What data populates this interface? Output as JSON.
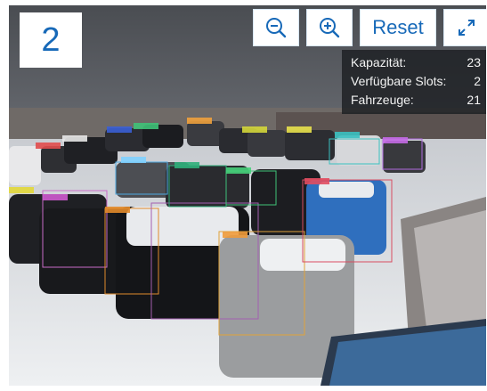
{
  "view": {
    "number": "2"
  },
  "toolbar": {
    "zoom_out_icon": "zoom-out-icon",
    "zoom_in_icon": "zoom-in-icon",
    "reset_label": "Reset",
    "fullscreen_icon": "fullscreen-icon"
  },
  "stats": {
    "rows": [
      {
        "label": "Kapazität:",
        "value": "23"
      },
      {
        "label": "Verfügbare Slots:",
        "value": "2"
      },
      {
        "label": "Fahrzeuge:",
        "value": "21"
      }
    ]
  },
  "colors": {
    "accent": "#1769b8",
    "overlay": "#1c1e22",
    "snow": "#e9ebee"
  }
}
